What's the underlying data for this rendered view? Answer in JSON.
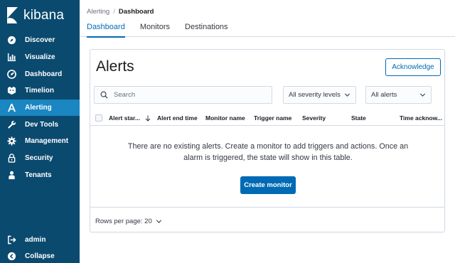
{
  "brand": {
    "name": "kibana"
  },
  "sidebar": {
    "items": [
      {
        "label": "Discover",
        "icon": "compass-icon"
      },
      {
        "label": "Visualize",
        "icon": "bar-chart-icon"
      },
      {
        "label": "Dashboard",
        "icon": "dashboard-gauge-icon"
      },
      {
        "label": "Timelion",
        "icon": "timelion-icon"
      },
      {
        "label": "Alerting",
        "icon": "alerting-a-icon",
        "active": true
      },
      {
        "label": "Dev Tools",
        "icon": "wrench-icon"
      },
      {
        "label": "Management",
        "icon": "gear-icon"
      },
      {
        "label": "Security",
        "icon": "lock-icon"
      },
      {
        "label": "Tenants",
        "icon": "user-icon"
      }
    ],
    "bottom": [
      {
        "label": "admin",
        "icon": "logout-icon"
      },
      {
        "label": "Collapse",
        "icon": "collapse-icon"
      }
    ]
  },
  "breadcrumb": {
    "parent": "Alerting",
    "separator": "/",
    "current": "Dashboard"
  },
  "tabs": [
    {
      "label": "Dashboard",
      "active": true
    },
    {
      "label": "Monitors",
      "active": false
    },
    {
      "label": "Destinations",
      "active": false
    }
  ],
  "panel": {
    "title": "Alerts",
    "acknowledge_label": "Acknowledge",
    "search_placeholder": "Search",
    "severity_select": "All severity levels",
    "alerts_select": "All alerts",
    "columns": [
      "Alert star...",
      "Alert end time",
      "Monitor name",
      "Trigger name",
      "Severity",
      "State",
      "Time acknow..."
    ],
    "empty_message": "There are no existing alerts. Create a monitor to add triggers and actions. Once an alarm is triggered, the state will show in this table.",
    "create_monitor_label": "Create monitor",
    "rows_per_page": "Rows per page: 20"
  },
  "colors": {
    "sidebar_bg": "#0b4a6f",
    "sidebar_active": "#1a86c2",
    "accent": "#006bb4",
    "border": "#d3dae6"
  }
}
